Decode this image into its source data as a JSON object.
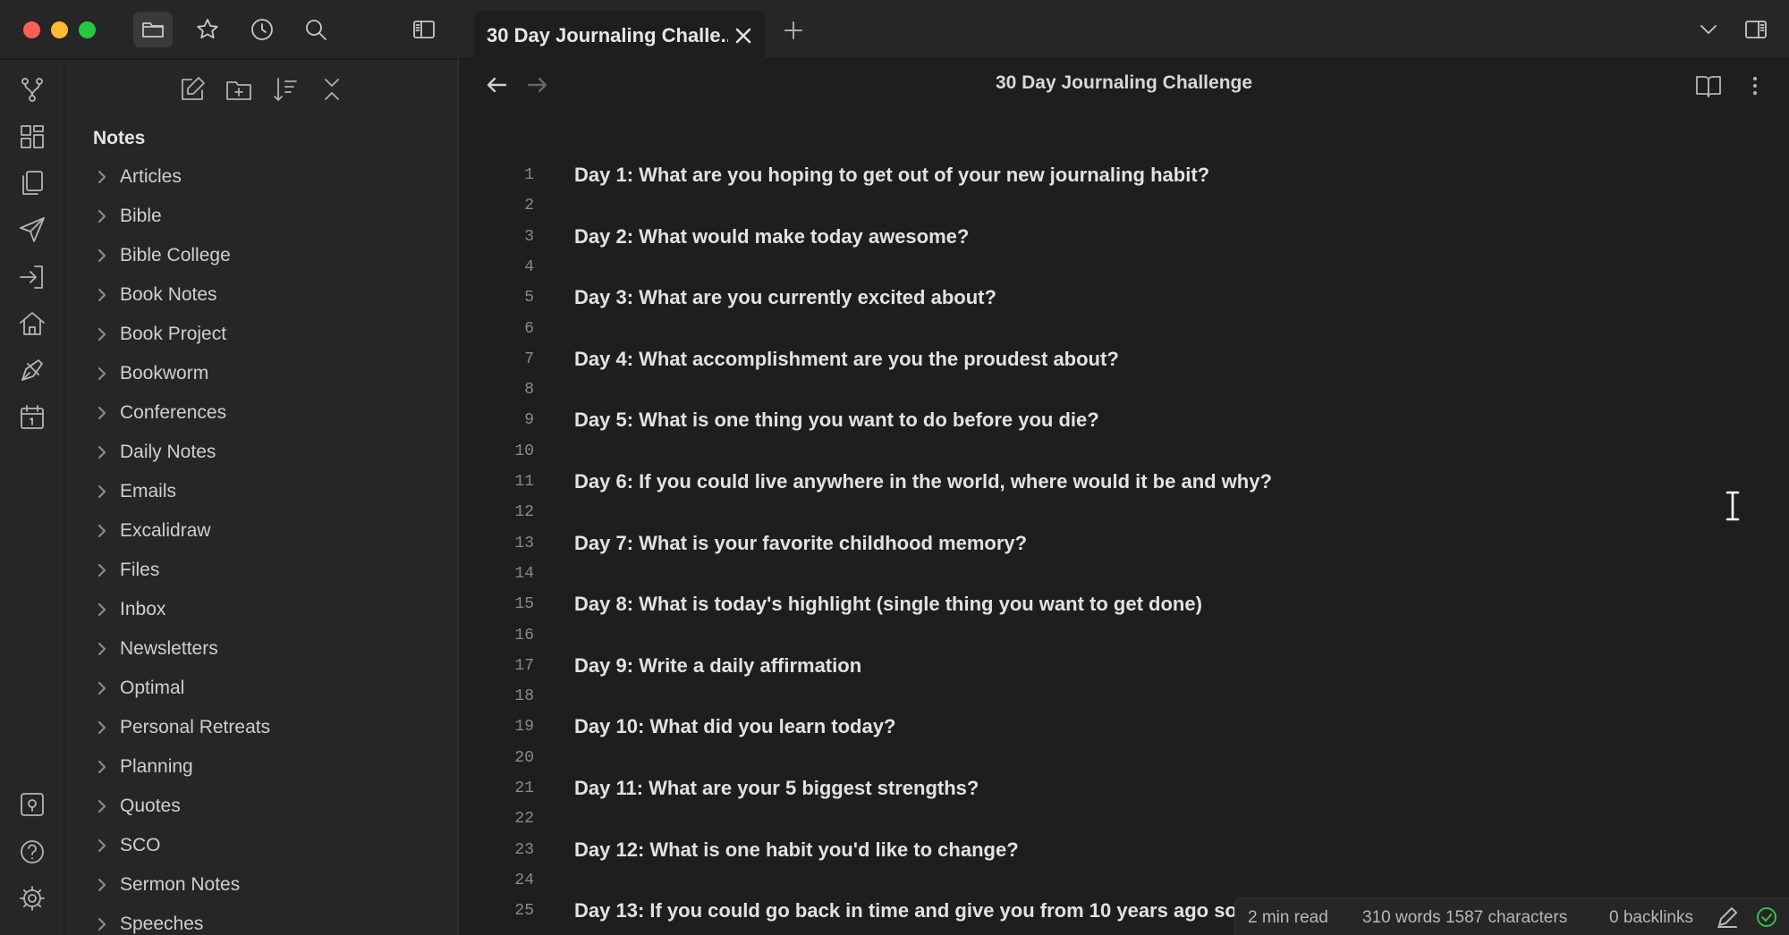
{
  "tab": {
    "title": "30 Day Journaling Challe..."
  },
  "note": {
    "title": "30 Day Journaling Challenge"
  },
  "sidebar": {
    "vault_name": "Notes",
    "folders": [
      "Articles",
      "Bible",
      "Bible College",
      "Book Notes",
      "Book Project",
      "Bookworm",
      "Conferences",
      "Daily Notes",
      "Emails",
      "Excalidraw",
      "Files",
      "Inbox",
      "Newsletters",
      "Optimal",
      "Personal Retreats",
      "Planning",
      "Quotes",
      "SCO",
      "Sermon Notes",
      "Speeches"
    ]
  },
  "editor": {
    "lines": [
      {
        "n": "1",
        "text": "Day 1: What are you hoping to get out of your new journaling habit?"
      },
      {
        "n": "2",
        "text": ""
      },
      {
        "n": "3",
        "text": "Day 2: What would make today awesome?"
      },
      {
        "n": "4",
        "text": ""
      },
      {
        "n": "5",
        "text": "Day 3: What are you currently excited about?"
      },
      {
        "n": "6",
        "text": ""
      },
      {
        "n": "7",
        "text": "Day 4: What accomplishment are you the proudest about?"
      },
      {
        "n": "8",
        "text": ""
      },
      {
        "n": "9",
        "text": "Day 5: What is one thing you want to do before you die?"
      },
      {
        "n": "10",
        "text": ""
      },
      {
        "n": "11",
        "text": "Day 6: If you could live anywhere in the world, where would it be and why?"
      },
      {
        "n": "12",
        "text": ""
      },
      {
        "n": "13",
        "text": "Day 7: What is your favorite childhood memory?"
      },
      {
        "n": "14",
        "text": ""
      },
      {
        "n": "15",
        "text": "Day 8: What is today's highlight (single thing you want to get done)"
      },
      {
        "n": "16",
        "text": ""
      },
      {
        "n": "17",
        "text": "Day 9: Write a daily affirmation"
      },
      {
        "n": "18",
        "text": ""
      },
      {
        "n": "19",
        "text": "Day 10: What did you learn today?"
      },
      {
        "n": "20",
        "text": ""
      },
      {
        "n": "21",
        "text": "Day 11: What are your 5 biggest strengths?"
      },
      {
        "n": "22",
        "text": ""
      },
      {
        "n": "23",
        "text": "Day 12: What is one habit you'd like to change?"
      },
      {
        "n": "24",
        "text": ""
      },
      {
        "n": "25",
        "text": "Day 13: If you could go back in time and give you from 10 years ago so"
      }
    ]
  },
  "status": {
    "read_time": "2 min read",
    "counts": "310 words 1587 characters",
    "backlinks": "0 backlinks"
  },
  "colors": {
    "background": "#1e1e1e",
    "panel": "#262626",
    "sync_ok": "#3fb950"
  }
}
